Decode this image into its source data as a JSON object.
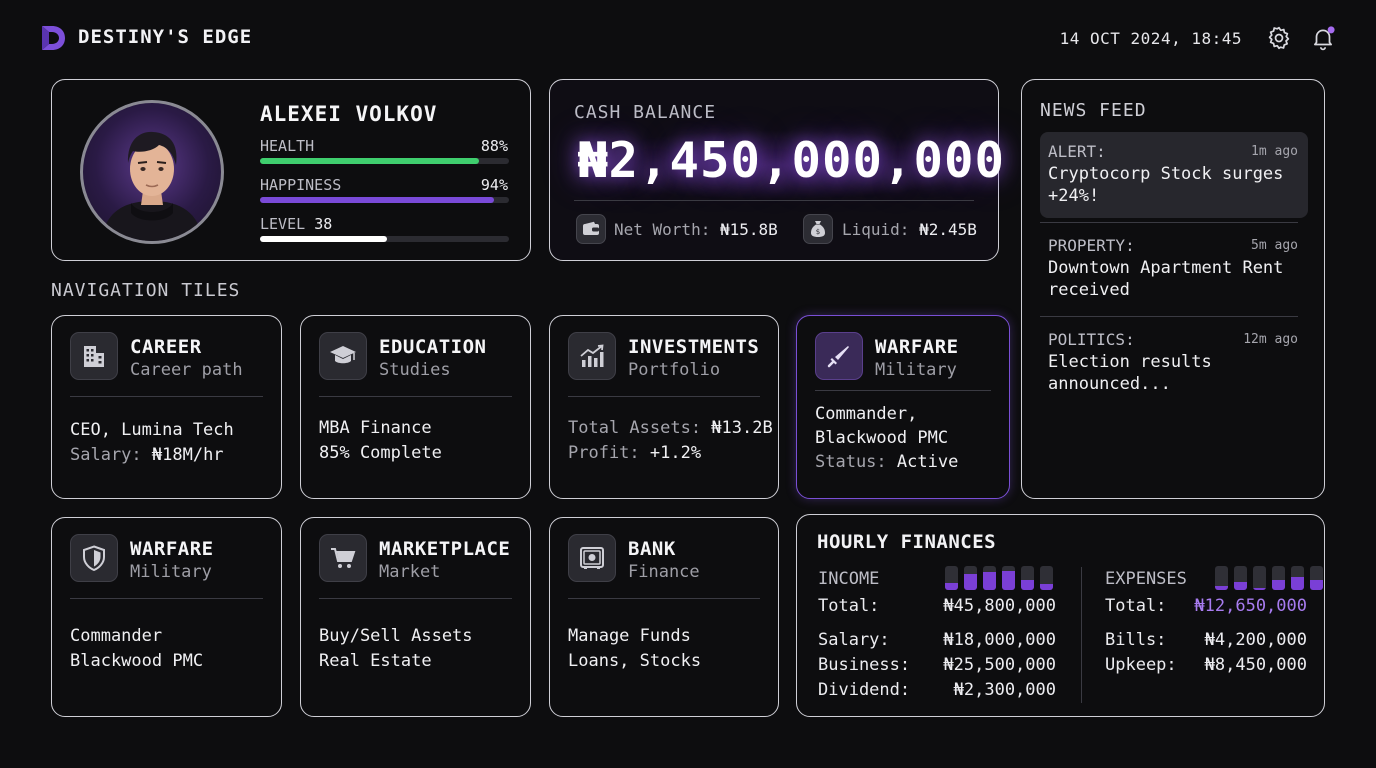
{
  "header": {
    "app_title": "DESTINY'S EDGE",
    "datetime": "14 OCT 2024, 18:45",
    "accent_color": "#8b5cf6",
    "notification_dot_color": "#a66cf0"
  },
  "profile": {
    "name": "ALEXEI VOLKOV",
    "stats": [
      {
        "label": "HEALTH",
        "value": "88%",
        "fill": 0.88,
        "color": "#3fce6e"
      },
      {
        "label": "HAPPINESS",
        "value": "94%",
        "fill": 0.94,
        "color": "#7a4ad8"
      },
      {
        "label": "LEVEL",
        "value": "38",
        "fill": 0.51,
        "color": "#ffffff"
      }
    ]
  },
  "cash": {
    "label": "CASH BALANCE",
    "amount": "₦2,450,000,000",
    "net_worth_label": "Net Worth:",
    "net_worth_value": "₦15.8B",
    "liquid_label": "Liquid:",
    "liquid_value": "₦2.45B"
  },
  "news": {
    "title": "NEWS FEED",
    "items": [
      {
        "category": "ALERT:",
        "time": "1m ago",
        "text": "Cryptocorp Stock surges +24%!"
      },
      {
        "category": "PROPERTY:",
        "time": "5m ago",
        "text": "Downtown Apartment Rent received"
      },
      {
        "category": "POLITICS:",
        "time": "12m ago",
        "text": "Election results announced..."
      }
    ]
  },
  "navigation": {
    "label": "NAVIGATION TILES",
    "tiles": [
      {
        "title": "CAREER",
        "subtitle": "Career path",
        "icon": "building-icon",
        "lines": [
          {
            "a": "CEO, Lumina Tech",
            "b": ""
          },
          {
            "a": "Salary:",
            "b": " ₦18M/hr"
          }
        ]
      },
      {
        "title": "EDUCATION",
        "subtitle": "Studies",
        "icon": "graduation-cap-icon",
        "lines": [
          {
            "a": "MBA Finance",
            "b": ""
          },
          {
            "a": "85% Complete",
            "b": ""
          }
        ]
      },
      {
        "title": "INVESTMENTS",
        "subtitle": "Portfolio",
        "icon": "chart-up-icon",
        "lines": [
          {
            "a": "Total Assets:",
            "b": " ₦13.2B"
          },
          {
            "a": "Profit:",
            "b": " +1.2%"
          }
        ]
      },
      {
        "title": "WARFARE",
        "subtitle": "Military",
        "icon": "sword-icon",
        "lines": [
          {
            "a": "Commander,",
            "b": ""
          },
          {
            "a": "Blackwood PMC",
            "b": ""
          },
          {
            "a": "Status:",
            "b": " Active"
          }
        ]
      },
      {
        "title": "WARFARE",
        "subtitle": "Military",
        "icon": "shield-icon",
        "lines": [
          {
            "a": "Commander",
            "b": ""
          },
          {
            "a": "Blackwood PMC",
            "b": ""
          }
        ]
      },
      {
        "title": "MARKETPLACE",
        "subtitle": "Market",
        "icon": "cart-icon",
        "lines": [
          {
            "a": "Buy/Sell Assets",
            "b": ""
          },
          {
            "a": "Real Estate",
            "b": ""
          }
        ]
      },
      {
        "title": "BANK",
        "subtitle": "Finance",
        "icon": "safe-icon",
        "lines": [
          {
            "a": "Manage Funds",
            "b": ""
          },
          {
            "a": "Loans, Stocks",
            "b": ""
          }
        ]
      }
    ]
  },
  "finances": {
    "title": "HOURLY FINANCES",
    "income": {
      "label": "INCOME",
      "total_label": "Total:",
      "total_value": "₦45,800,000",
      "bars": [
        0.3,
        0.65,
        0.75,
        0.8,
        0.4,
        0.25
      ],
      "rows": [
        {
          "label": "Salary:",
          "value": "₦18,000,000"
        },
        {
          "label": "Business:",
          "value": "₦25,500,000"
        },
        {
          "label": "Dividend:",
          "value": "₦2,300,000"
        }
      ]
    },
    "expenses": {
      "label": "EXPENSES",
      "total_label": "Total:",
      "total_value": "₦12,650,000",
      "total_color": "#a87cf0",
      "bars": [
        0.15,
        0.35,
        0.1,
        0.4,
        0.55,
        0.4
      ],
      "rows": [
        {
          "label": "Bills:",
          "value": "₦4,200,000"
        },
        {
          "label": "Upkeep:",
          "value": "₦8,450,000"
        }
      ]
    }
  }
}
